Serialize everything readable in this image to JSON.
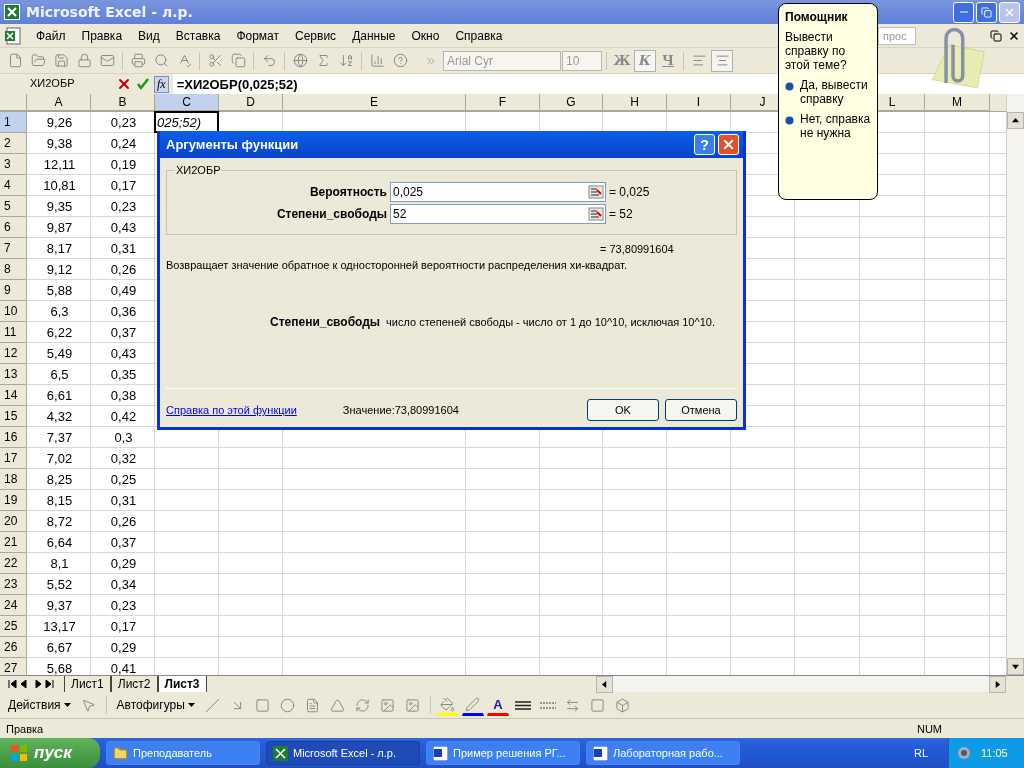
{
  "window": {
    "title": "Microsoft Excel - л.р."
  },
  "menu": [
    {
      "label": "Файл"
    },
    {
      "label": "Правка"
    },
    {
      "label": "Вид"
    },
    {
      "label": "Вставка"
    },
    {
      "label": "Формат"
    },
    {
      "label": "Сервис"
    },
    {
      "label": "Данные"
    },
    {
      "label": "Окно"
    },
    {
      "label": "Справка"
    }
  ],
  "question_box": {
    "placeholder": "прос"
  },
  "toolbar": {
    "font": "Arial Cyr",
    "size": "10",
    "styles": [
      {
        "label": "Ж",
        "selected": false
      },
      {
        "label": "К",
        "selected": true
      },
      {
        "label": "Ч",
        "selected": false
      }
    ]
  },
  "formula_bar": {
    "name_box": "ХИ2ОБР",
    "fx": "fx",
    "formula": "=ХИ2ОБР(0,025;52)"
  },
  "columns": [
    {
      "label": "A",
      "selected": false
    },
    {
      "label": "B",
      "selected": false
    },
    {
      "label": "C",
      "selected": true
    },
    {
      "label": "D",
      "selected": false
    },
    {
      "label": "E",
      "selected": false
    },
    {
      "label": "F",
      "selected": false
    },
    {
      "label": "G",
      "selected": false
    },
    {
      "label": "H",
      "selected": false
    },
    {
      "label": "I",
      "selected": false
    },
    {
      "label": "J",
      "selected": false
    },
    {
      "label": "L",
      "selected": false
    },
    {
      "label": "M",
      "selected": false
    }
  ],
  "rows": [
    {
      "num": "1",
      "selected": true,
      "cells": [
        "9,26",
        "0,23",
        "025;52)"
      ]
    },
    {
      "num": "2",
      "selected": false,
      "cells": [
        "9,38",
        "0,24"
      ]
    },
    {
      "num": "3",
      "selected": false,
      "cells": [
        "12,11",
        "0,19"
      ]
    },
    {
      "num": "4",
      "selected": false,
      "cells": [
        "10,81",
        "0,17"
      ]
    },
    {
      "num": "5",
      "selected": false,
      "cells": [
        "9,35",
        "0,23"
      ]
    },
    {
      "num": "6",
      "selected": false,
      "cells": [
        "9,87",
        "0,43"
      ]
    },
    {
      "num": "7",
      "selected": false,
      "cells": [
        "8,17",
        "0,31"
      ]
    },
    {
      "num": "8",
      "selected": false,
      "cells": [
        "9,12",
        "0,26"
      ]
    },
    {
      "num": "9",
      "selected": false,
      "cells": [
        "5,88",
        "0,49"
      ]
    },
    {
      "num": "10",
      "selected": false,
      "cells": [
        "6,3",
        "0,36"
      ]
    },
    {
      "num": "11",
      "selected": false,
      "cells": [
        "6,22",
        "0,37"
      ]
    },
    {
      "num": "12",
      "selected": false,
      "cells": [
        "5,49",
        "0,43"
      ]
    },
    {
      "num": "13",
      "selected": false,
      "cells": [
        "6,5",
        "0,35"
      ]
    },
    {
      "num": "14",
      "selected": false,
      "cells": [
        "6,61",
        "0,38"
      ]
    },
    {
      "num": "15",
      "selected": false,
      "cells": [
        "4,32",
        "0,42"
      ]
    },
    {
      "num": "16",
      "selected": false,
      "cells": [
        "7,37",
        "0,3"
      ]
    },
    {
      "num": "17",
      "selected": false,
      "cells": [
        "7,02",
        "0,32"
      ]
    },
    {
      "num": "18",
      "selected": false,
      "cells": [
        "8,25",
        "0,25"
      ]
    },
    {
      "num": "19",
      "selected": false,
      "cells": [
        "8,15",
        "0,31"
      ]
    },
    {
      "num": "20",
      "selected": false,
      "cells": [
        "8,72",
        "0,26"
      ]
    },
    {
      "num": "21",
      "selected": false,
      "cells": [
        "6,64",
        "0,37"
      ]
    },
    {
      "num": "22",
      "selected": false,
      "cells": [
        "8,1",
        "0,29"
      ]
    },
    {
      "num": "23",
      "selected": false,
      "cells": [
        "5,52",
        "0,34"
      ]
    },
    {
      "num": "24",
      "selected": false,
      "cells": [
        "9,37",
        "0,23"
      ]
    },
    {
      "num": "25",
      "selected": false,
      "cells": [
        "13,17",
        "0,17"
      ]
    },
    {
      "num": "26",
      "selected": false,
      "cells": [
        "6,67",
        "0,29"
      ]
    },
    {
      "num": "27",
      "selected": false,
      "cells": [
        "5,68",
        "0,41"
      ]
    }
  ],
  "sheet_tabs": [
    {
      "label": "Лист1",
      "selected": false
    },
    {
      "label": "Лист2",
      "selected": false
    },
    {
      "label": "Лист3",
      "selected": true
    }
  ],
  "drawing_toolbar": {
    "actions": "Действия",
    "autoshapes": "Автофигуры",
    "font_color": "A"
  },
  "status_bar": {
    "mode": "Правка",
    "indicator": "NUM"
  },
  "dialog": {
    "title": "Аргументы функции",
    "help": "?",
    "group": "ХИ2ОБР",
    "args": [
      {
        "label": "Вероятность",
        "value": "0,025",
        "result": "= 0,025"
      },
      {
        "label": "Степени_свободы",
        "value": "52",
        "result": "= 52"
      }
    ],
    "result": "= 73,80991604",
    "description": "Возвращает значение обратное к односторонней вероятности распределения хи-квадрат.",
    "arg_help_label": "Степени_свободы",
    "arg_help_text": "число степеней свободы - число от 1 до 10^10, исключая 10^10.",
    "link": "Справка по этой функции",
    "value_text": "Значение:73,80991604",
    "buttons": [
      "OK",
      "Отмена"
    ]
  },
  "assistant": {
    "title": "Помощник",
    "question": "Вывести справку по этой теме?",
    "options": [
      "Да, вывести справку",
      "Нет, справка не нужна"
    ]
  },
  "taskbar": {
    "start": "пуск",
    "tasks": [
      {
        "label": "Преподаватель",
        "kind": "folder",
        "selected": false
      },
      {
        "label": "Microsoft Excel - л.р.",
        "kind": "excel",
        "selected": true
      },
      {
        "label": "Пример решения РГ...",
        "kind": "word",
        "selected": false
      },
      {
        "label": "Лабораторная рабо...",
        "kind": "word",
        "selected": false
      }
    ],
    "language": "RL",
    "clock": "11:05"
  }
}
